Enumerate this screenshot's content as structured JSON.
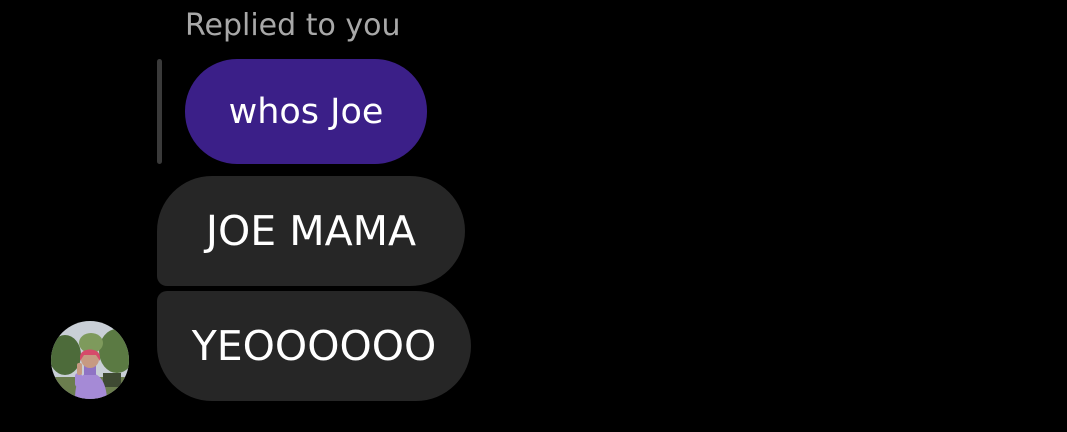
{
  "thread": {
    "reply_caption": "Replied to you",
    "quoted_message": "whos Joe",
    "messages": [
      {
        "text": "JOE MAMA"
      },
      {
        "text": "YEOOOOOO"
      }
    ],
    "avatar_icon": "user-avatar-photo"
  },
  "colors": {
    "background": "#000000",
    "quoted_bubble": "#3b1f88",
    "incoming_bubble": "#262626",
    "caption_text": "#a8a8a8",
    "message_text": "#ffffff"
  }
}
